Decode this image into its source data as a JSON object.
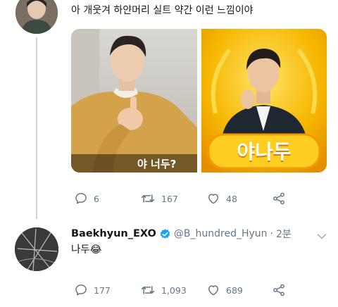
{
  "tweet1": {
    "text": "아 개웃겨 하얀머리 실트 약간 이런 느낌이야",
    "images": [
      {
        "caption": "야 너두?"
      },
      {
        "caption": "야나두"
      }
    ],
    "actions": {
      "reply": "6",
      "retweet": "167",
      "like": "48"
    }
  },
  "tweet2": {
    "display_name": "Baekhyun_EXO",
    "handle": "@B_hundred_Hyun",
    "separator": "·",
    "time": "2분",
    "text": "나두😂",
    "actions": {
      "reply": "177",
      "retweet": "1,093",
      "like": "689"
    }
  },
  "colors": {
    "verified": "#1da1f2",
    "icon_gray": "#657786",
    "gold": "#f5b800"
  },
  "icons": [
    "reply-icon",
    "retweet-icon",
    "like-icon",
    "share-icon",
    "verified-badge-icon",
    "chevron-down-icon"
  ]
}
